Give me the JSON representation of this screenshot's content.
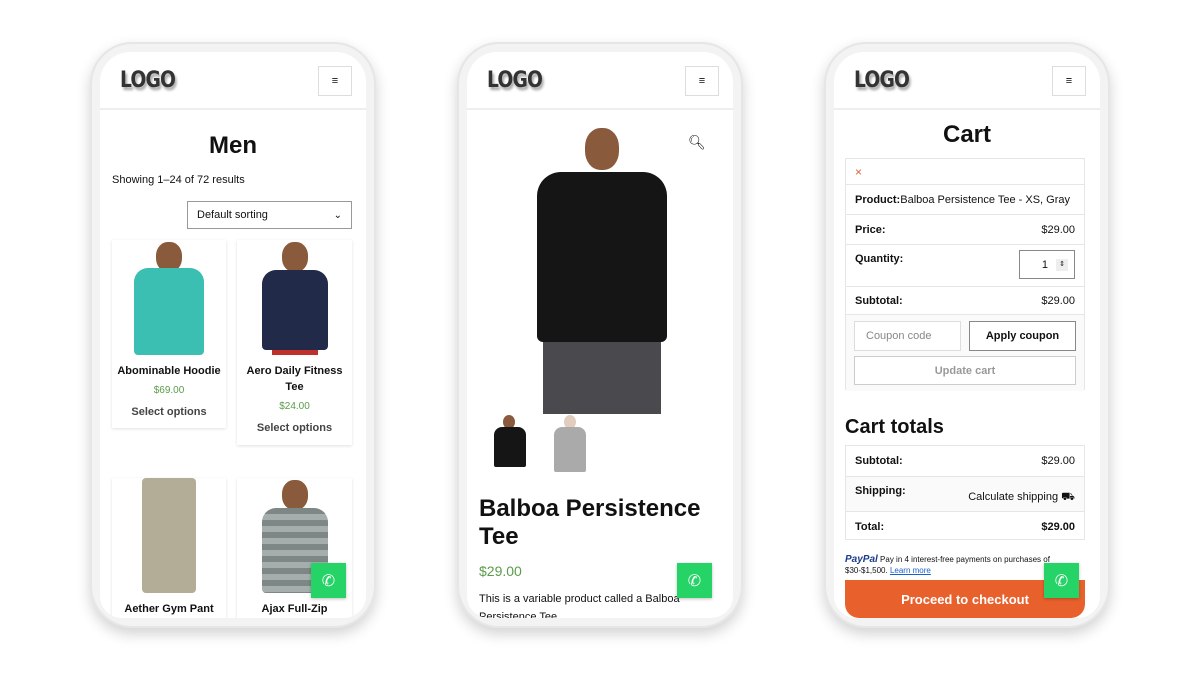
{
  "logo": "LOGO",
  "menu_icon": "hamburger-icon",
  "shop": {
    "title": "Men",
    "result_count": "Showing 1–24 of 72 results",
    "sorting": "Default sorting",
    "products": [
      {
        "name": "Abominable Hoodie",
        "price": "$69.00",
        "action": "Select options",
        "color": "#3bbfb3"
      },
      {
        "name": "Aero Daily Fitness Tee",
        "price": "$24.00",
        "action": "Select options",
        "color": "#222a4a"
      },
      {
        "name": "Aether Gym Pant",
        "color": "#b3ad97"
      },
      {
        "name": "Ajax Full-Zip",
        "color": "#7d8785"
      }
    ]
  },
  "product": {
    "title": "Balboa Persistence Tee",
    "price": "$29.00",
    "description": "This is a variable product called a Balboa Persistence Tee",
    "thumbnails": [
      "black",
      "gray"
    ]
  },
  "cart": {
    "title": "Cart",
    "remove_icon": "×",
    "product_label": "Product:",
    "product_value": "Balboa Persistence Tee - XS, Gray",
    "price_label": "Price:",
    "price_value": "$29.00",
    "quantity_label": "Quantity:",
    "quantity_value": "1",
    "subtotal_label": "Subtotal:",
    "subtotal_value": "$29.00",
    "coupon_placeholder": "Coupon code",
    "apply_coupon": "Apply coupon",
    "update_cart": "Update cart",
    "totals_title": "Cart totals",
    "totals": {
      "subtotal_label": "Subtotal:",
      "subtotal_value": "$29.00",
      "shipping_label": "Shipping:",
      "shipping_value": "Calculate shipping",
      "total_label": "Total:",
      "total_value": "$29.00"
    },
    "paypal_brand": "PayPal",
    "paypal_text": "Pay in 4 interest-free payments on purchases of $30-$1,500.",
    "paypal_link": "Learn more",
    "checkout": "Proceed to checkout",
    "checkout_color": "#e8602c"
  },
  "whatsapp_color": "#25d366"
}
